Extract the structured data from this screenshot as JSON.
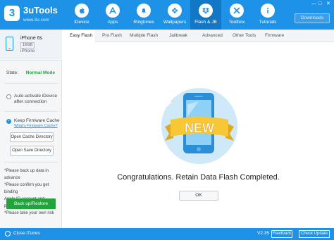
{
  "app": {
    "name": "3uTools",
    "url": "www.3u.com",
    "logo_glyph": "3",
    "accent": "#1e92e6",
    "accent_dark": "#1277c4",
    "success": "#23a33b"
  },
  "nav": {
    "items": [
      {
        "label": "iDevice",
        "icon": "apple-icon"
      },
      {
        "label": "Apps",
        "icon": "apps-icon"
      },
      {
        "label": "Ringtones",
        "icon": "bell-icon"
      },
      {
        "label": "Wallpapers",
        "icon": "flower-icon"
      },
      {
        "label": "Flash & JB",
        "icon": "dropbox-icon",
        "active": true
      },
      {
        "label": "Toolbox",
        "icon": "tools-icon"
      },
      {
        "label": "Tutorials",
        "icon": "info-icon"
      }
    ],
    "downloads_label": "Downloads"
  },
  "window_controls": [
    "minimize-icon",
    "maximize-icon",
    "close-icon"
  ],
  "device": {
    "name": "iPhone 6s",
    "capacity": "16GB",
    "type": "iPhone"
  },
  "state": {
    "label": "State:",
    "value": "Normal Mode"
  },
  "options": {
    "auto_activate": "Auto-activate iDevice after connection",
    "keep_firmware": "Keep Firmware Cache",
    "what_link": "What's Firmware Cache?",
    "open_cache": "Open Cache Directory",
    "open_save": "Open Save Directory"
  },
  "notes": {
    "line1": "*Please back up data in advance",
    "line2": "*Please confirm you get binding",
    "line3": "Apple ID account and password",
    "line4": "*Please take your own risk"
  },
  "backup_button": "Back up/Restore",
  "tabs": [
    {
      "label": "Easy Flash",
      "active": true
    },
    {
      "label": "Pro Flash"
    },
    {
      "label": "Multiple Flash"
    },
    {
      "label": "Jailbreak"
    },
    {
      "label": "Advanced"
    },
    {
      "label": "Other Tools"
    },
    {
      "label": "Firmware"
    }
  ],
  "illustration": {
    "badge_text": "NEW",
    "colors": {
      "circle": "#cfe9f8",
      "ribbon": "#f7c735",
      "ribbon_dark": "#e0a81e",
      "phone": "#2a8fd8"
    }
  },
  "message": "Congratulations. Retain Data Flash Completed.",
  "ok_button": "OK",
  "footer": {
    "close_itunes": "Close iTunes",
    "version": "V2.35",
    "feedback": "Feedback",
    "check_update": "Check Update"
  }
}
